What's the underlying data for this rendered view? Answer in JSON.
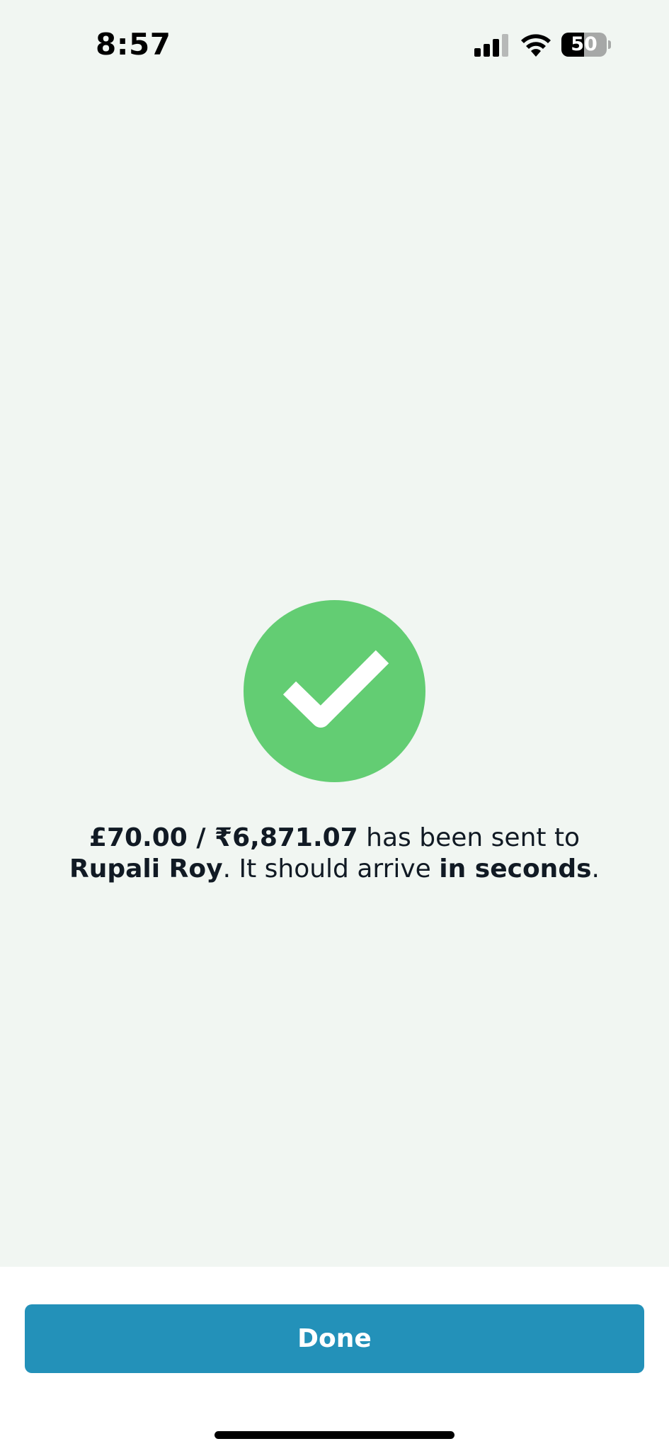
{
  "status_bar": {
    "time": "8:57",
    "battery_level": "50",
    "battery_fraction": 0.5,
    "signal_icon": "cellular-signal-icon",
    "wifi_icon": "wifi-icon"
  },
  "confirmation": {
    "icon": "checkmark-success-icon",
    "amount": "£70.00 / ₹6,871.07",
    "sent_text": " has been sent to ",
    "recipient": "Rupali Roy",
    "arrive_text": ". It should arrive ",
    "arrival_time": "in seconds",
    "end_punctuation": "."
  },
  "actions": {
    "done_label": "Done"
  },
  "colors": {
    "background": "#f1f6f2",
    "success": "#63cd73",
    "primary_button": "#2391b9",
    "text": "#111a24"
  }
}
